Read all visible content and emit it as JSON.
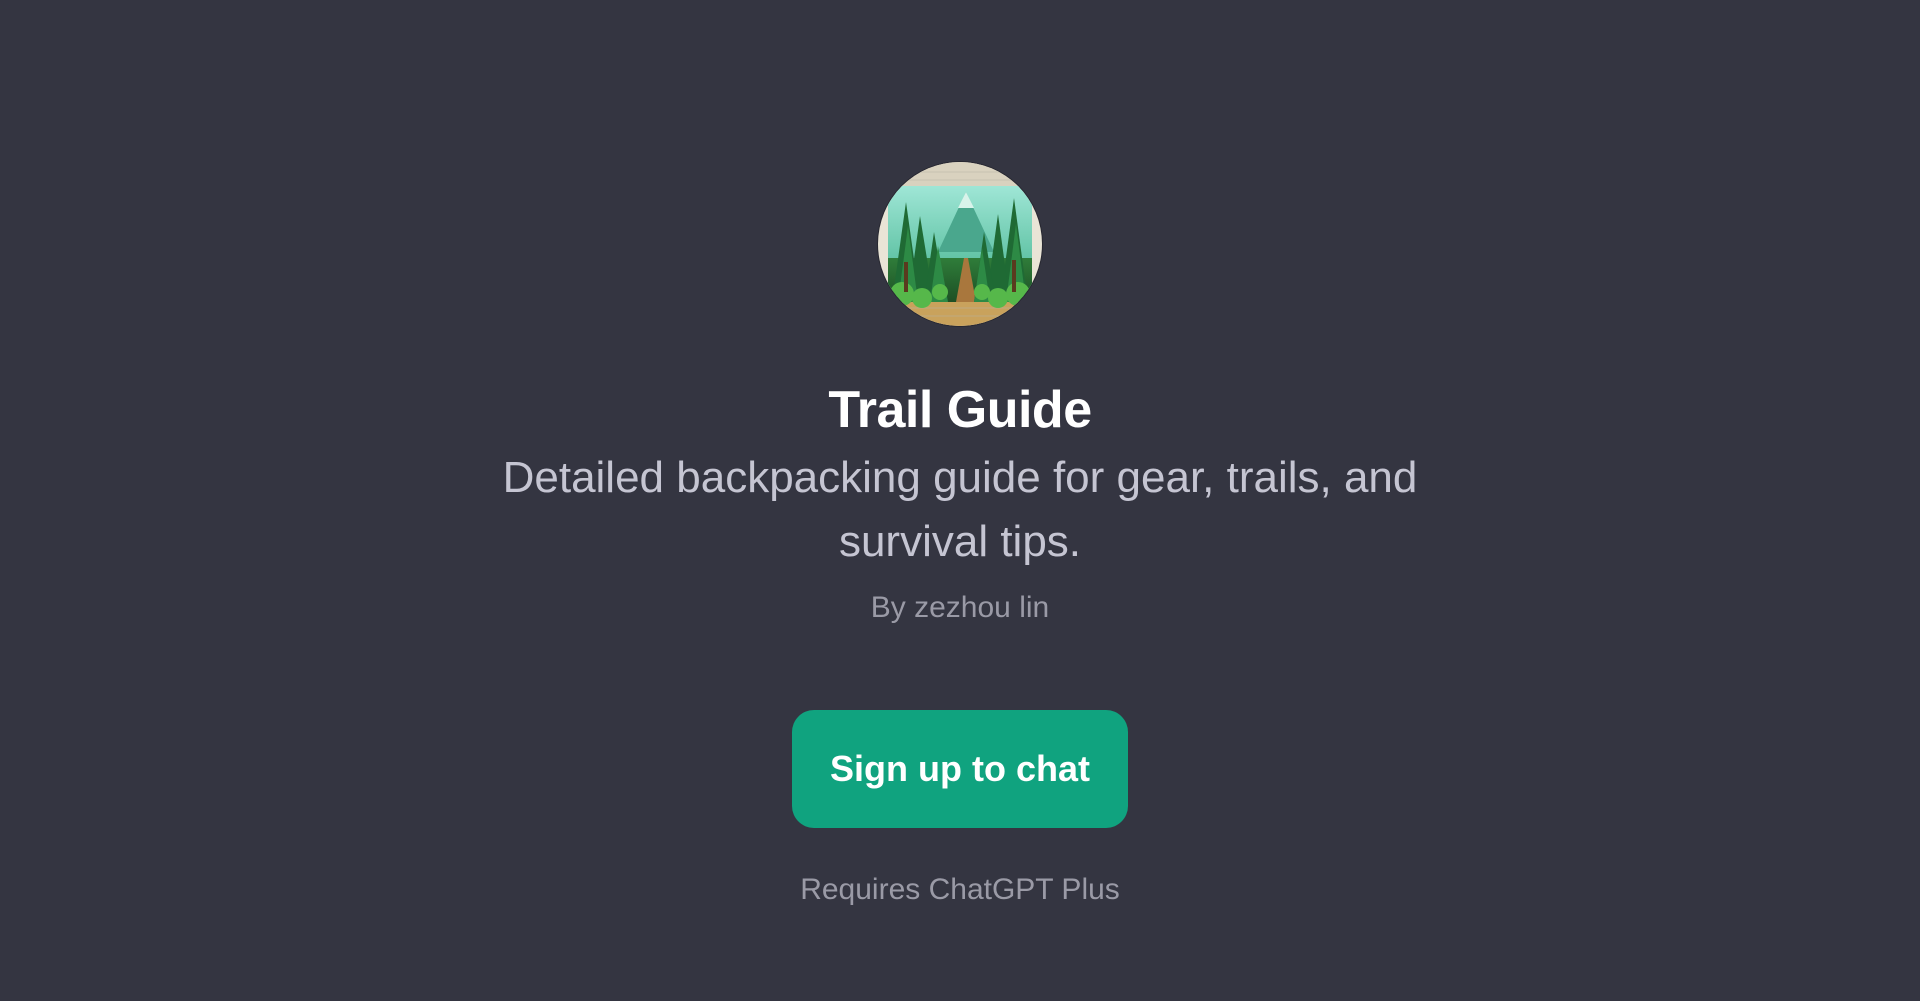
{
  "colors": {
    "background": "#343541",
    "accent": "#10a37f",
    "title": "#ffffff",
    "description": "#c5c5d2",
    "muted": "#9a9aa6"
  },
  "gpt": {
    "avatar_icon": "forest-trail-illustration",
    "title": "Trail Guide",
    "description": "Detailed backpacking guide for gear, trails, and survival tips.",
    "author": "By zezhou lin"
  },
  "actions": {
    "signup_label": "Sign up to chat",
    "requires_note": "Requires ChatGPT Plus"
  }
}
